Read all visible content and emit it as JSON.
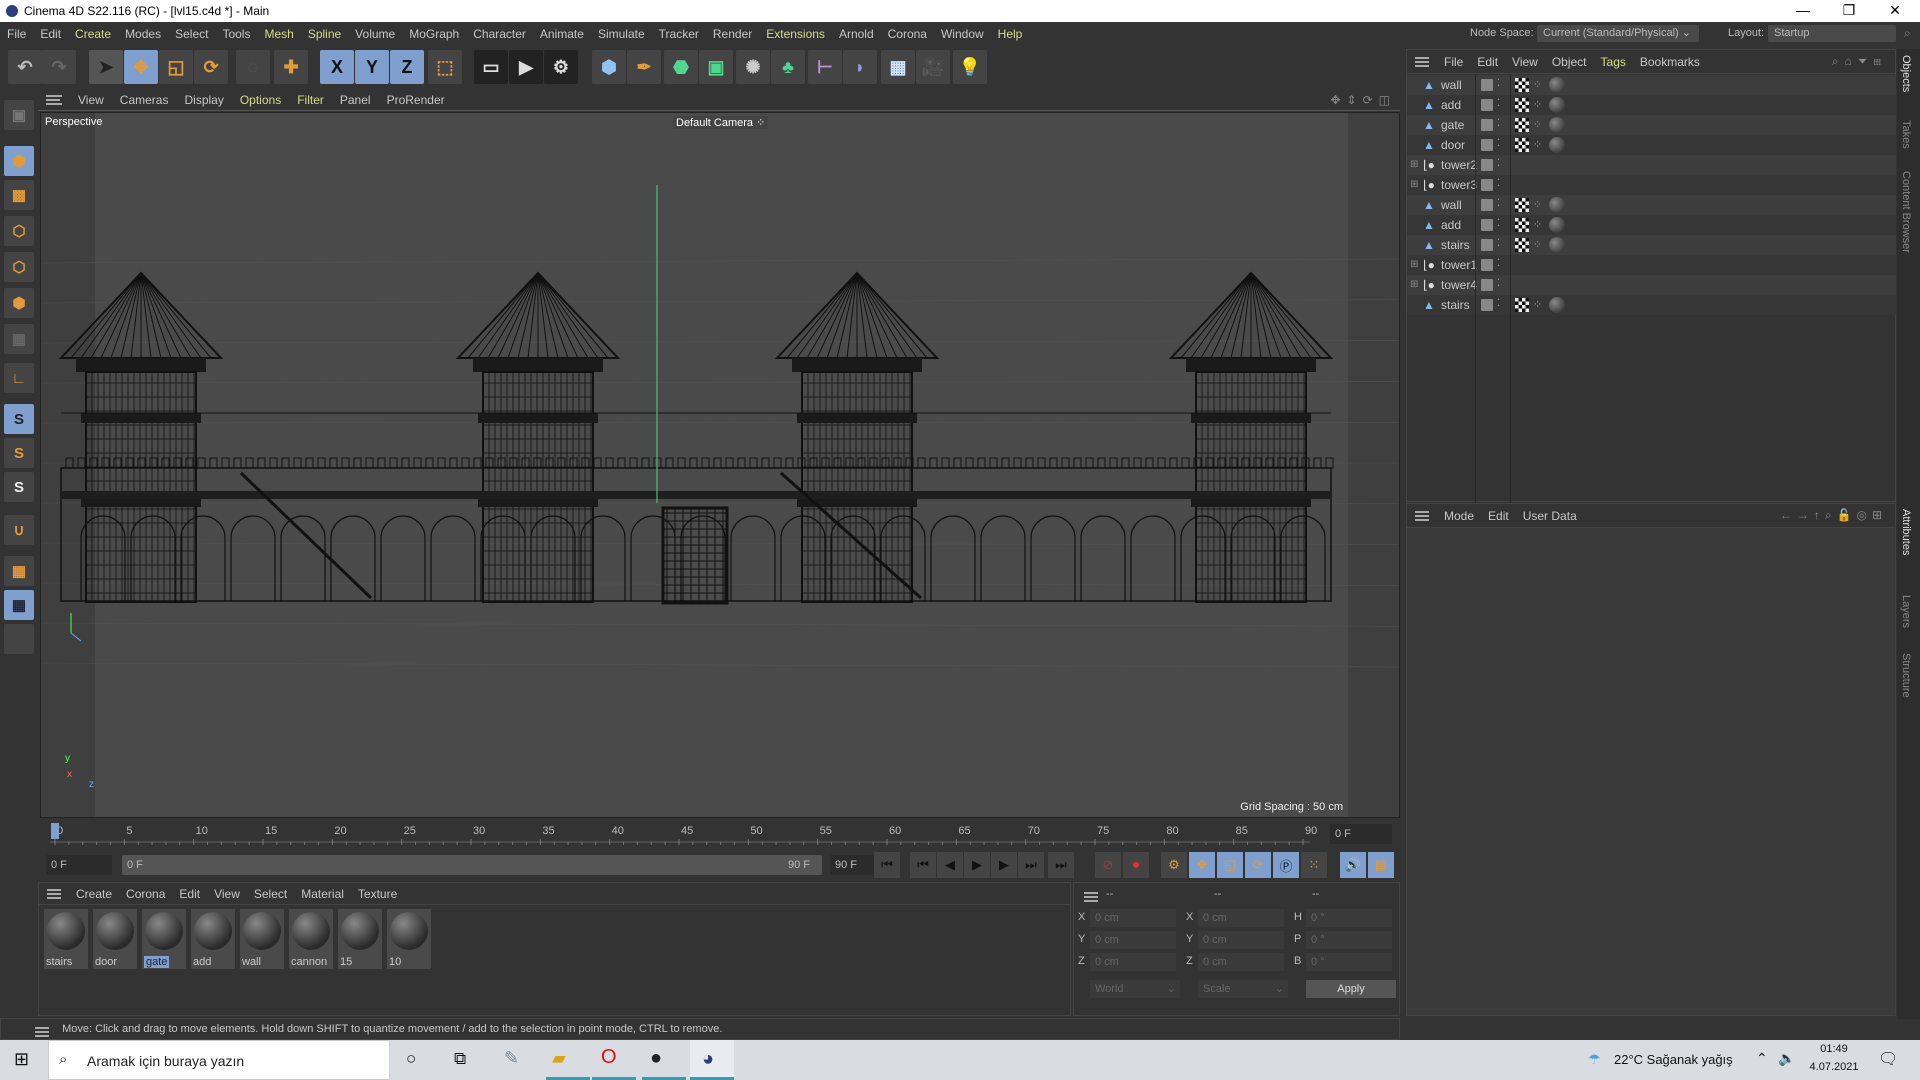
{
  "window": {
    "title": "Cinema 4D S22.116 (RC) - [lvl15.c4d *] - Main",
    "minimize": "—",
    "restore": "❐",
    "close": "✕"
  },
  "menu": [
    "File",
    "Edit",
    "Create",
    "Modes",
    "Select",
    "Tools",
    "Mesh",
    "Spline",
    "Volume",
    "MoGraph",
    "Character",
    "Animate",
    "Simulate",
    "Tracker",
    "Render",
    "Extensions",
    "Arnold",
    "Corona",
    "Window",
    "Help"
  ],
  "menu_highlight": [
    "Create",
    "Mesh",
    "Spline",
    "Extensions",
    "Help"
  ],
  "node_space": {
    "label": "Node Space:",
    "value": "Current (Standard/Physical)"
  },
  "layout": {
    "label": "Layout:",
    "value": "Startup"
  },
  "toolbar": {
    "undo": "↶",
    "redo": "↷",
    "select": "➤",
    "move": "✥",
    "scale": "◱",
    "rotate": "⟳",
    "axis_x": "X",
    "axis_y": "Y",
    "axis_z": "Z"
  },
  "viewport": {
    "menu": [
      "View",
      "Cameras",
      "Display",
      "Options",
      "Filter",
      "Panel",
      "ProRender"
    ],
    "menu_highlight": [
      "Options",
      "Filter"
    ],
    "view_name": "Perspective",
    "camera": "Default Camera",
    "grid_spacing": "Grid Spacing : 50 cm",
    "axis_y": "y",
    "axis_z": "z",
    "axis_x": "x"
  },
  "timeline": {
    "ticks": [
      0,
      5,
      10,
      15,
      20,
      25,
      30,
      35,
      40,
      45,
      50,
      55,
      60,
      65,
      70,
      75,
      80,
      85,
      90
    ],
    "min": 0,
    "max": 90,
    "current": 0,
    "current_field": "0 F"
  },
  "frame": {
    "start": "0 F",
    "range_start": "0 F",
    "range_end": "90 F",
    "end": "90 F"
  },
  "materials": {
    "menu": [
      "Create",
      "Corona",
      "Edit",
      "View",
      "Select",
      "Material",
      "Texture"
    ],
    "items": [
      {
        "name": "stairs"
      },
      {
        "name": "door"
      },
      {
        "name": "gate",
        "selected": true
      },
      {
        "name": "add"
      },
      {
        "name": "wall"
      },
      {
        "name": "cannon"
      },
      {
        "name": "15"
      },
      {
        "name": "10"
      }
    ]
  },
  "coords": {
    "headers": [
      "--",
      "--",
      "--"
    ],
    "rows": [
      {
        "a": "X",
        "av": "0 cm",
        "b": "X",
        "bv": "0 cm",
        "c": "H",
        "cv": "0 °"
      },
      {
        "a": "Y",
        "av": "0 cm",
        "b": "Y",
        "bv": "0 cm",
        "c": "P",
        "cv": "0 °"
      },
      {
        "a": "Z",
        "av": "0 cm",
        "b": "Z",
        "bv": "0 cm",
        "c": "B",
        "cv": "0 °"
      }
    ],
    "space": "World",
    "mode": "Scale",
    "apply": "Apply"
  },
  "status": "Move: Click and drag to move elements. Hold down SHIFT to quantize movement / add to the selection in point mode, CTRL to remove.",
  "objects": {
    "menu": [
      "File",
      "Edit",
      "View",
      "Object",
      "Tags",
      "Bookmarks"
    ],
    "items": [
      {
        "name": "wall",
        "type": "poly",
        "tags": true
      },
      {
        "name": "add",
        "type": "poly",
        "tags": true
      },
      {
        "name": "gate",
        "type": "poly",
        "tags": true
      },
      {
        "name": "door",
        "type": "poly",
        "tags": true
      },
      {
        "name": "tower2",
        "type": "null",
        "tags": false
      },
      {
        "name": "tower3",
        "type": "null",
        "tags": false
      },
      {
        "name": "wall",
        "type": "poly",
        "tags": true
      },
      {
        "name": "add",
        "type": "poly",
        "tags": true
      },
      {
        "name": "stairs",
        "type": "poly",
        "tags": true
      },
      {
        "name": "tower1",
        "type": "null",
        "tags": false
      },
      {
        "name": "tower4",
        "type": "null",
        "tags": false
      },
      {
        "name": "stairs",
        "type": "poly",
        "tags": true
      }
    ]
  },
  "attributes": {
    "menu": [
      "Mode",
      "Edit",
      "User Data"
    ]
  },
  "side_tabs": {
    "top": [
      "Objects",
      "Takes",
      "Content Browser"
    ],
    "bottom": [
      "Attributes",
      "Layers",
      "Structure"
    ]
  },
  "taskbar": {
    "search_placeholder": "Aramak için buraya yazın",
    "weather": "22°C  Sağanak yağış",
    "time": "01:49",
    "date": "4.07.2021"
  },
  "colors": {
    "accent": "#7f9fcf",
    "highlight_text": "#d6dc8a",
    "orange": "#e39a3b"
  }
}
